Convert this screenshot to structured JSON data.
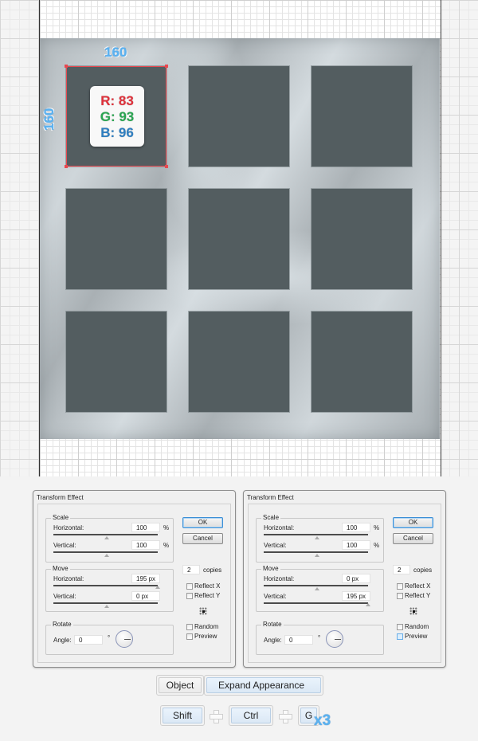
{
  "canvas": {
    "dimension_width": "160",
    "dimension_height": "160",
    "square_color": "#535d60",
    "selection_color": "#e84850",
    "rgb": {
      "r_label": "R: 83",
      "g_label": "G: 93",
      "b_label": "B: 96",
      "r_color": "#e0303a",
      "g_color": "#2aa552",
      "b_color": "#2f7fc1"
    }
  },
  "dialogs": [
    {
      "title": "Transform Effect",
      "scale": {
        "legend": "Scale",
        "horizontal_label": "Horizontal:",
        "horizontal_value": "100",
        "horizontal_unit": "%",
        "vertical_label": "Vertical:",
        "vertical_value": "100",
        "vertical_unit": "%"
      },
      "move": {
        "legend": "Move",
        "horizontal_label": "Horizontal:",
        "horizontal_value": "195 px",
        "vertical_label": "Vertical:",
        "vertical_value": "0 px"
      },
      "rotate": {
        "legend": "Rotate",
        "angle_label": "Angle:",
        "angle_value": "0",
        "angle_unit": "°"
      },
      "ok_label": "OK",
      "cancel_label": "Cancel",
      "copies_value": "2",
      "copies_label": "copies",
      "reflect_x": "Reflect X",
      "reflect_y": "Reflect Y",
      "random": "Random",
      "preview": "Preview"
    },
    {
      "title": "Transform Effect",
      "scale": {
        "legend": "Scale",
        "horizontal_label": "Horizontal:",
        "horizontal_value": "100",
        "horizontal_unit": "%",
        "vertical_label": "Vertical:",
        "vertical_value": "100",
        "vertical_unit": "%"
      },
      "move": {
        "legend": "Move",
        "horizontal_label": "Horizontal:",
        "horizontal_value": "0 px",
        "vertical_label": "Vertical:",
        "vertical_value": "195 px"
      },
      "rotate": {
        "legend": "Rotate",
        "angle_label": "Angle:",
        "angle_value": "0",
        "angle_unit": "°"
      },
      "ok_label": "OK",
      "cancel_label": "Cancel",
      "copies_value": "2",
      "copies_label": "copies",
      "reflect_x": "Reflect X",
      "reflect_y": "Reflect Y",
      "random": "Random",
      "preview": "Preview"
    }
  ],
  "menu": {
    "object": "Object",
    "expand_appearance": "Expand Appearance"
  },
  "shortcut": {
    "keys": [
      "Shift",
      "Ctrl",
      "G"
    ],
    "repeat": "x3"
  }
}
